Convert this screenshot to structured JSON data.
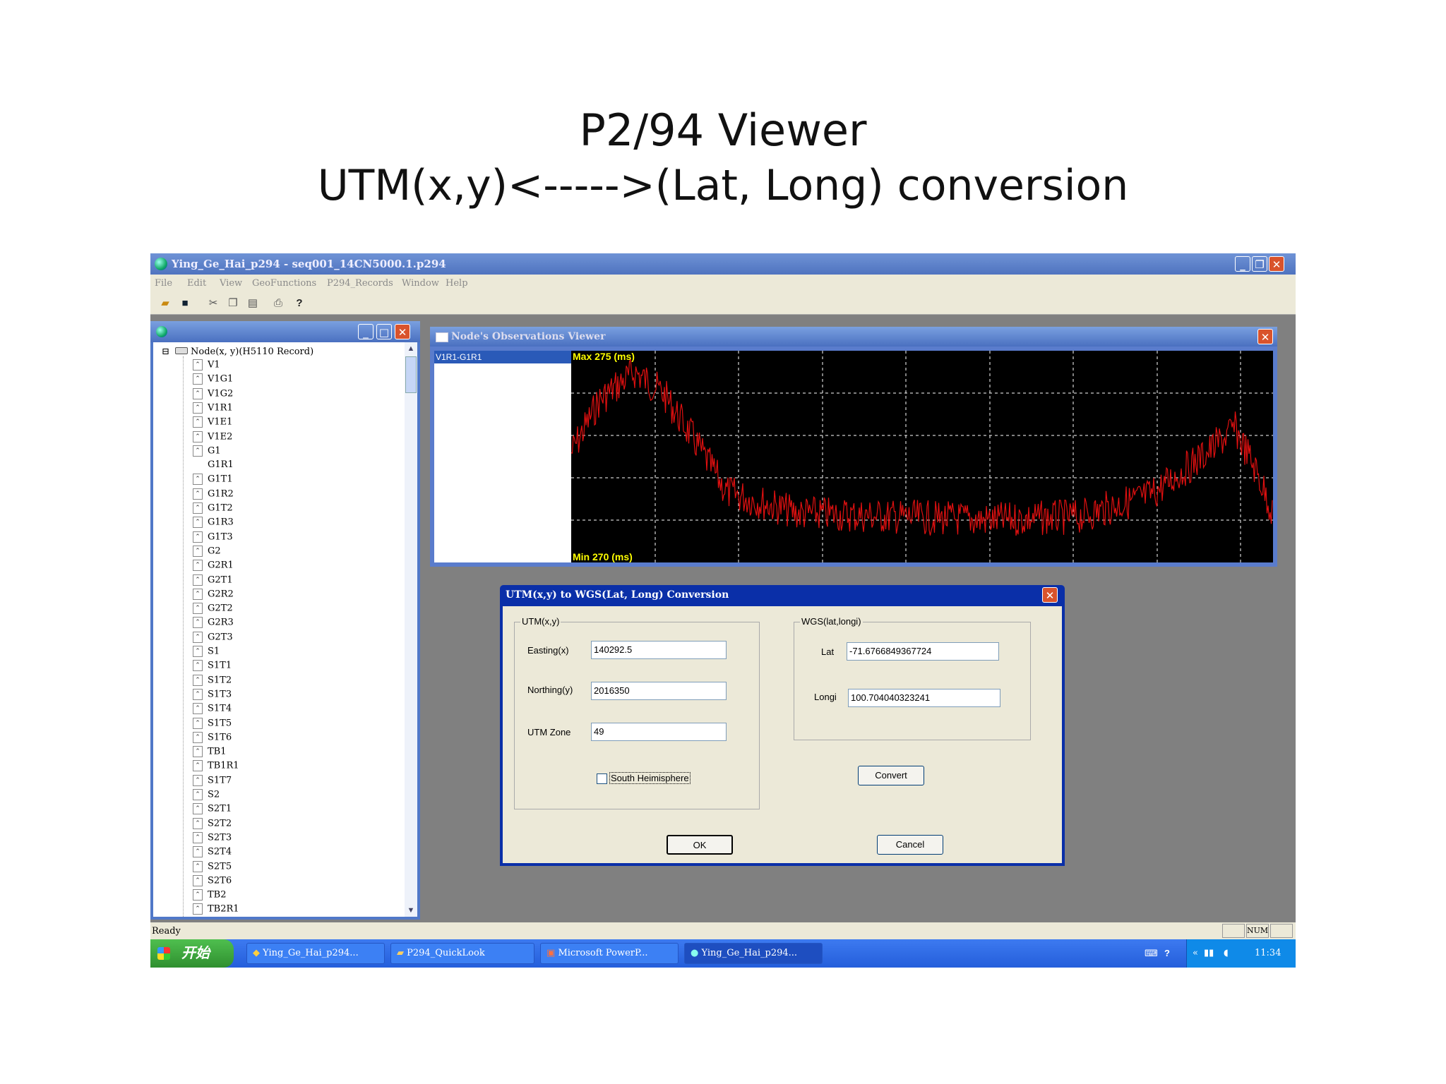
{
  "slide": {
    "title": "P2/94 Viewer",
    "subtitle": "UTM(x,y)<----->(Lat, Long) conversion"
  },
  "app": {
    "title": "Ying_Ge_Hai_p294 - seq001_14CN5000.1.p294",
    "menus": [
      "File",
      "Edit",
      "View",
      "GeoFunctions",
      "P294_Records",
      "Window",
      "Help"
    ],
    "toolbar_icons": [
      "open-icon",
      "save-icon",
      "cut-icon",
      "copy-icon",
      "paste-icon",
      "print-icon",
      "help-icon"
    ],
    "status": "Ready",
    "status_num": "NUM"
  },
  "tree": {
    "root": "Node(x, y)(H5110 Record)",
    "items": [
      "V1",
      "V1G1",
      "V1G2",
      "V1R1",
      "V1E1",
      "V1E2",
      "G1",
      "G1R1",
      "G1T1",
      "G1R2",
      "G1T2",
      "G1R3",
      "G1T3",
      "G2",
      "G2R1",
      "G2T1",
      "G2R2",
      "G2T2",
      "G2R3",
      "G2T3",
      "S1",
      "S1T1",
      "S1T2",
      "S1T3",
      "S1T4",
      "S1T5",
      "S1T6",
      "TB1",
      "TB1R1",
      "S1T7",
      "S2",
      "S2T1",
      "S2T2",
      "S2T3",
      "S2T4",
      "S2T5",
      "S2T6",
      "TB2",
      "TB2R1"
    ]
  },
  "observations": {
    "title": "Node's Observations Viewer",
    "selected": "V1R1-G1R1",
    "max_label": "Max 275 (ms)",
    "min_label": "Min 270 (ms)"
  },
  "dialog": {
    "title": "UTM(x,y) to WGS(Lat, Long) Conversion",
    "utm_group": "UTM(x,y)",
    "easting_label": "Easting(x)",
    "easting_value": "140292.5",
    "northing_label": "Northing(y)",
    "northing_value": "2016350",
    "zone_label": "UTM Zone",
    "zone_value": "49",
    "south_label": "South Heimisphere",
    "south_checked": false,
    "wgs_group": "WGS(lat,longi)",
    "lat_label": "Lat",
    "lat_value": "-71.6766849367724",
    "longi_label": "Longi",
    "longi_value": "100.704040323241",
    "convert": "Convert",
    "ok": "OK",
    "cancel": "Cancel"
  },
  "taskbar": {
    "start": "开始",
    "tasks": [
      "Ying_Ge_Hai_p294...",
      "P294_QuickLook",
      "Microsoft PowerP...",
      "Ying_Ge_Hai_p294..."
    ],
    "clock": "11:34"
  },
  "colors": {
    "trace": "#e01010",
    "plot_bg": "#000000",
    "max_label": "#ffff00"
  }
}
